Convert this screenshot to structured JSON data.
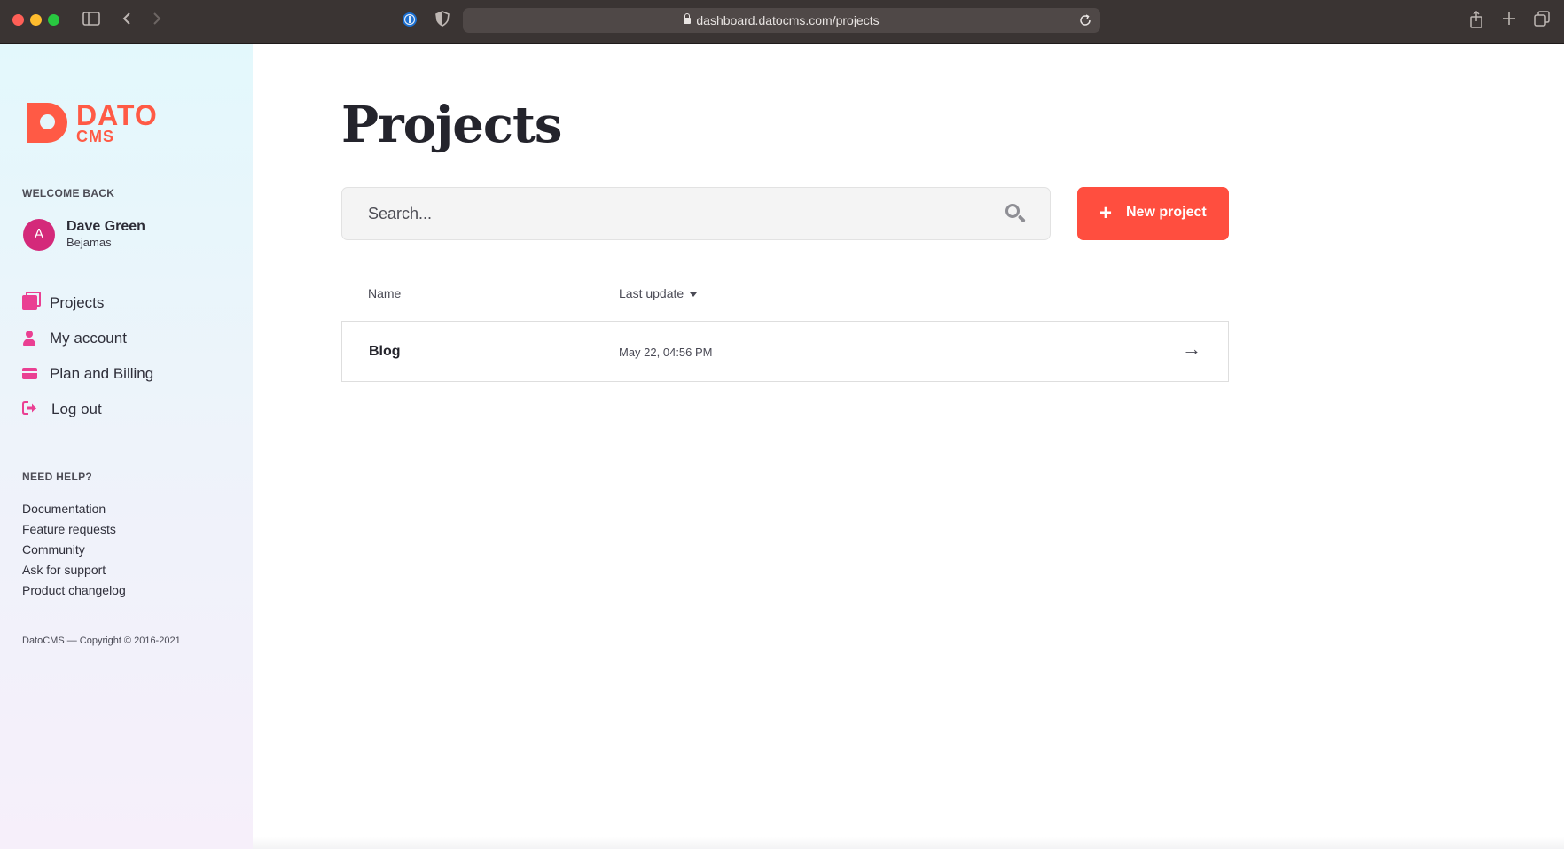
{
  "browser": {
    "url": "dashboard.datocms.com/projects"
  },
  "sidebar": {
    "logo": {
      "line1": "DATO",
      "line2": "CMS"
    },
    "welcome_label": "WELCOME BACK",
    "user": {
      "avatar_letter": "A",
      "name": "Dave Green",
      "org": "Bejamas"
    },
    "nav": [
      {
        "label": "Projects",
        "icon": "projects-icon"
      },
      {
        "label": "My account",
        "icon": "user-icon"
      },
      {
        "label": "Plan and Billing",
        "icon": "credit-card-icon"
      },
      {
        "label": "Log out",
        "icon": "logout-icon"
      }
    ],
    "help_title": "NEED HELP?",
    "help_links": [
      "Documentation",
      "Feature requests",
      "Community",
      "Ask for support",
      "Product changelog"
    ],
    "copyright": "DatoCMS — Copyright © 2016-2021"
  },
  "main": {
    "title": "Projects",
    "search_placeholder": "Search...",
    "new_project_label": "New project",
    "columns": {
      "name": "Name",
      "last_update": "Last update"
    },
    "rows": [
      {
        "name": "Blog",
        "last_update": "May 22, 04:56 PM"
      }
    ]
  },
  "colors": {
    "brand": "#ff5a45",
    "nav_icon": "#ea3f92",
    "avatar": "#d4297a"
  }
}
